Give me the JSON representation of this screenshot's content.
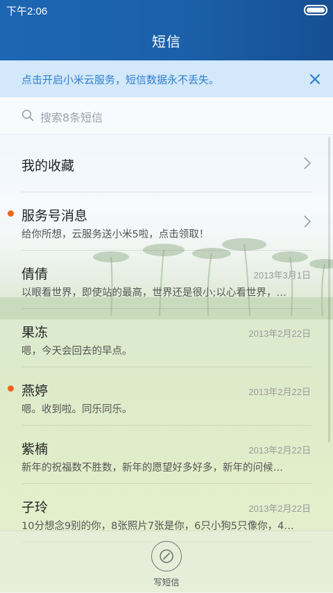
{
  "status_bar": {
    "time": "下午2:06"
  },
  "header": {
    "title": "短信"
  },
  "banner": {
    "text": "点击开启小米云服务，短信数据永不丢失。",
    "close_icon": "close-icon",
    "color": "#2e7fd2"
  },
  "search": {
    "placeholder": "搜索8条短信",
    "icon": "search-icon"
  },
  "favorites": {
    "label": "我的收藏"
  },
  "conversations": [
    {
      "name": "服务号消息",
      "preview": "给你所想，云服务送小米5啦，点击领取！",
      "date": "",
      "unread": true,
      "chevron": true
    },
    {
      "name": "倩倩",
      "preview": "以眼看世界，即使站的最高，世界还是很小;以心看世界，…",
      "date": "2013年3月1日",
      "unread": false,
      "chevron": false
    },
    {
      "name": "果冻",
      "preview": "嗯，今天会回去的早点。",
      "date": "2013年2月22日",
      "unread": false,
      "chevron": false
    },
    {
      "name": "燕婷",
      "preview": "嗯。收到啦。同乐同乐。",
      "date": "2013年2月22日",
      "unread": true,
      "chevron": false
    },
    {
      "name": "紫楠",
      "preview": "新年的祝福数不胜数，新年的愿望好多好多，新年的问候…",
      "date": "2013年2月22日",
      "unread": false,
      "chevron": false
    },
    {
      "name": "子玲",
      "preview": "10分想念9别的你，8张照片7张是你，6只小狗5只像你，4…",
      "date": "2013年2月22日",
      "unread": false,
      "chevron": false
    }
  ],
  "bottom": {
    "compose_label": "写短信",
    "compose_icon": "compose-icon"
  },
  "colors": {
    "header": "#1b60a9",
    "unread_dot": "#f0651e",
    "banner_text": "#2e7fd2"
  }
}
